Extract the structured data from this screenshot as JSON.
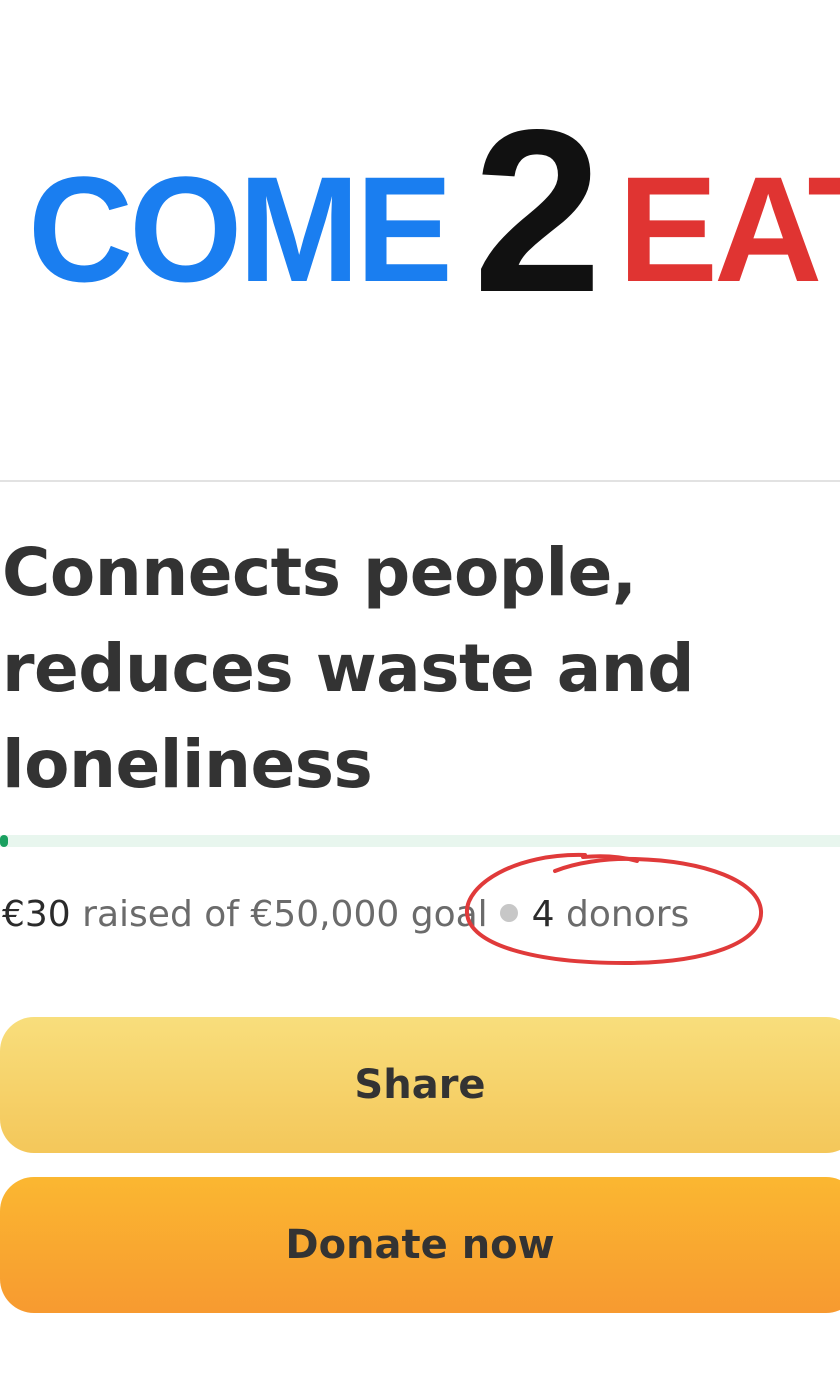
{
  "logo": {
    "part1": "COME",
    "part2": "2",
    "part3": "EAT",
    "colors": {
      "part1": "#1a7ef0",
      "part2": "#111111",
      "part3": "#e03432"
    }
  },
  "campaign": {
    "title": "Connects people, reduces waste and loneliness",
    "raised_amount": "€30",
    "raised_label": "raised of",
    "goal_amount": "€50,000",
    "goal_label": "goal",
    "donors_count": "4",
    "donors_label": "donors",
    "progress_fraction": 0.0006
  },
  "actions": {
    "share_label": "Share",
    "donate_label": "Donate now"
  },
  "colors": {
    "progress_fill": "#1aa060",
    "progress_track": "#e8f6ee",
    "share_button": "#f6d36c",
    "donate_button": "#f9a830",
    "annotation": "#e03a3a"
  }
}
